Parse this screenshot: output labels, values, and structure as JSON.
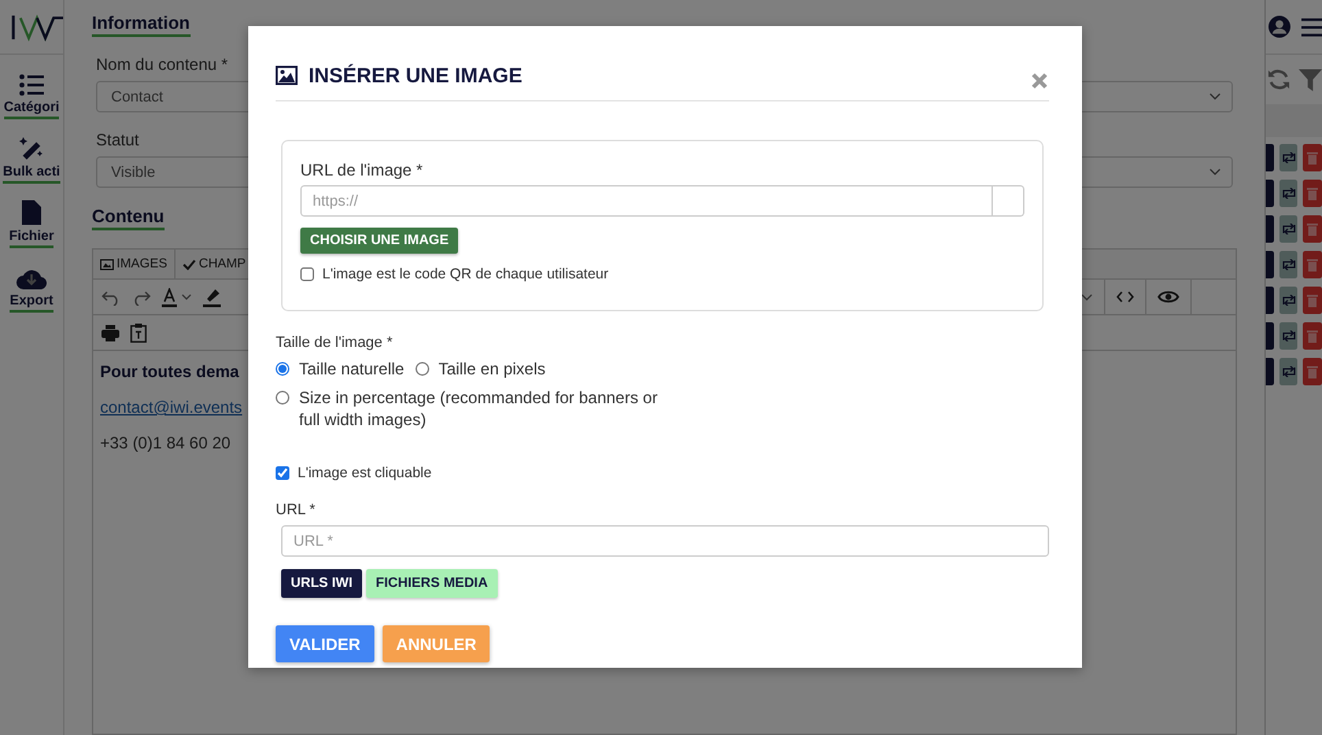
{
  "sidebar": {
    "items": [
      {
        "label": "Catégori"
      },
      {
        "label": "Bulk acti"
      },
      {
        "label": "Fichier"
      },
      {
        "label": "Export"
      }
    ]
  },
  "main": {
    "heading": "Information",
    "fields": [
      {
        "label": "Nom du contenu *",
        "value": "Contact"
      },
      {
        "label": "Statut",
        "value": "Visible"
      }
    ],
    "section": "Contenu",
    "editor": {
      "tabs": [
        "IMAGES",
        "CHAMP"
      ],
      "lines": [
        {
          "kind": "bold",
          "text": "Pour toutes dema"
        },
        {
          "kind": "link",
          "text": "contact@iwi.events"
        },
        {
          "kind": "plain",
          "text": "+33 (0)1 84 60 20"
        }
      ]
    }
  },
  "modal": {
    "title": "INSÉRER UNE IMAGE",
    "image_url": {
      "label": "URL de l'image *",
      "placeholder": "https://"
    },
    "choose_button": "CHOISIR UNE IMAGE",
    "qr_checkbox": {
      "label": "L'image est le code QR de chaque utilisateur",
      "checked": false
    },
    "size": {
      "label": "Taille de l'image *",
      "options": [
        {
          "label": "Taille naturelle",
          "selected": true
        },
        {
          "label": "Taille en pixels",
          "selected": false
        },
        {
          "label": "Size in percentage (recommanded for banners or full width images)",
          "selected": false
        }
      ]
    },
    "clickable": {
      "label": "L'image est cliquable",
      "checked": true
    },
    "url": {
      "label": "URL *",
      "placeholder": "URL *"
    },
    "source_buttons": [
      {
        "label": "URLS IWI",
        "kind": "dark"
      },
      {
        "label": "FICHIERS MEDIA",
        "kind": "light"
      }
    ],
    "actions": [
      {
        "label": "VALIDER",
        "kind": "primary"
      },
      {
        "label": "ANNULER",
        "kind": "cancel"
      }
    ]
  }
}
